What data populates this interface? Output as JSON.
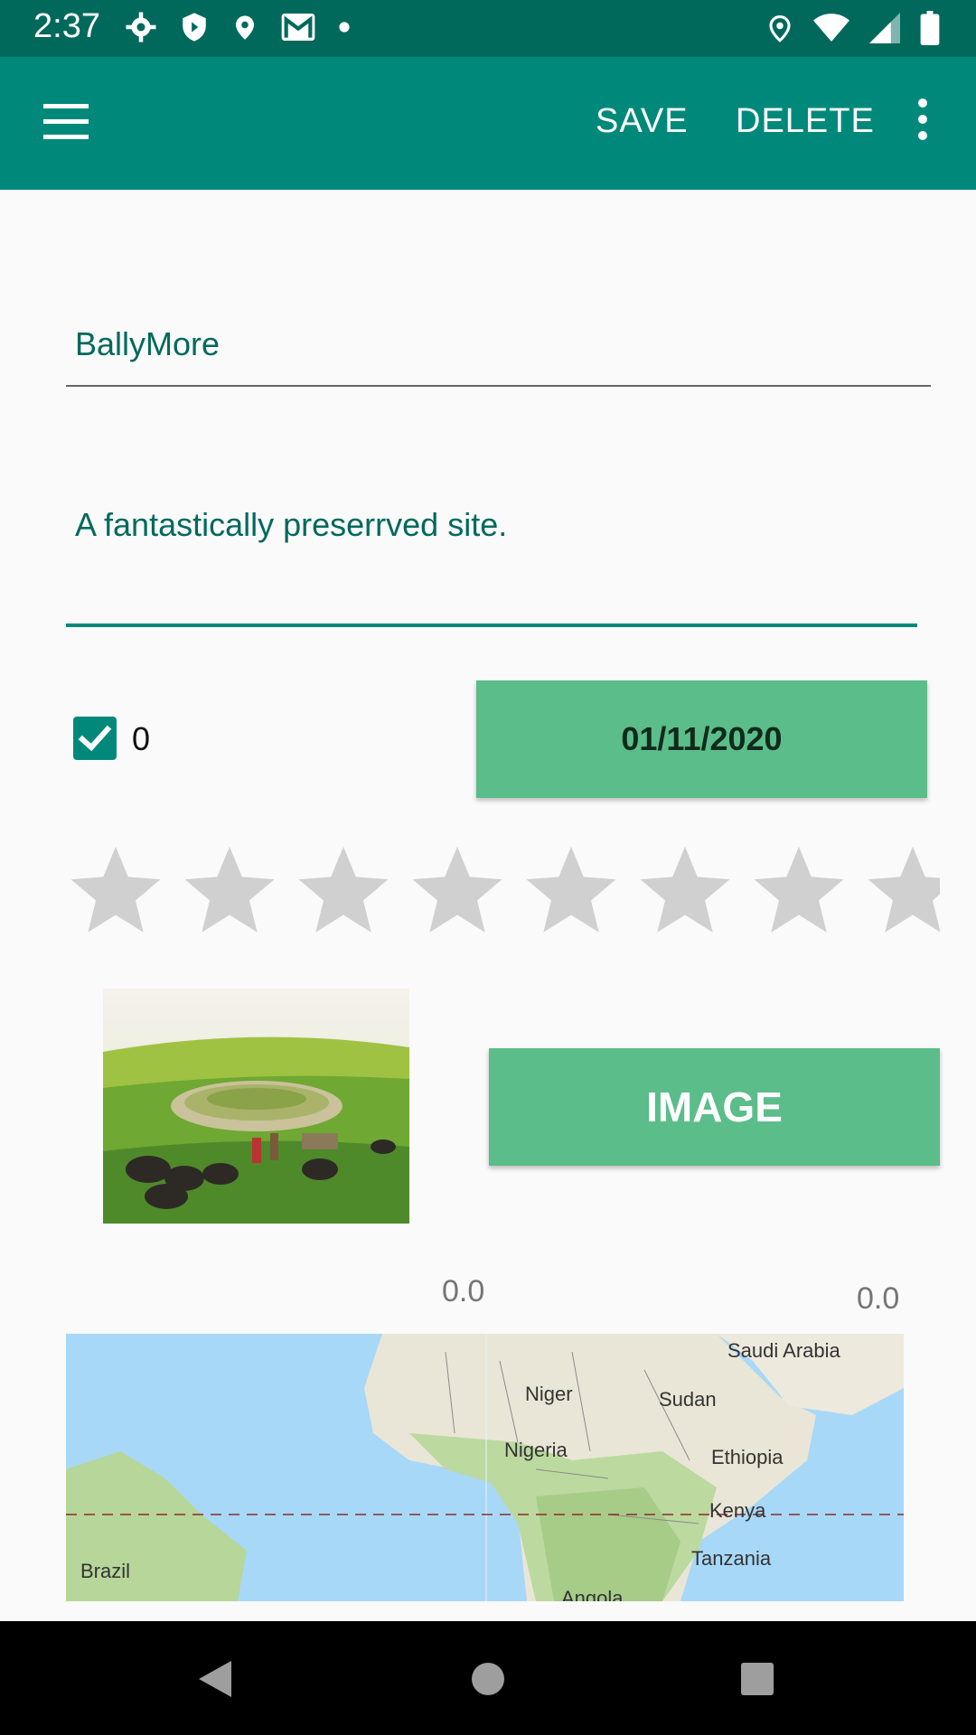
{
  "status_bar": {
    "time": "2:37"
  },
  "app_bar": {
    "save_label": "SAVE",
    "delete_label": "DELETE"
  },
  "form": {
    "title_value": "BallyMore",
    "description_value": "A fantastically preserrved site.",
    "visited_checked": true,
    "visited_label": "0",
    "date_label": "01/11/2020",
    "rating_stars_count": 8,
    "rating_filled": 0,
    "image_button_label": "IMAGE",
    "lat_value": "0.0",
    "lng_value": "0.0"
  },
  "map": {
    "labels": [
      "Saudi Arabia",
      "Niger",
      "Sudan",
      "Nigeria",
      "Ethiopia",
      "Kenya",
      "Brazil",
      "Tanzania",
      "Angola"
    ]
  },
  "colors": {
    "status_bar": "#00695c",
    "app_bar": "#00897b",
    "accent": "#00897b",
    "button": "#5bbd89"
  }
}
